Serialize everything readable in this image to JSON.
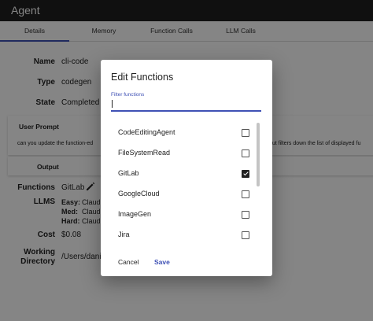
{
  "app": {
    "title": "Agent"
  },
  "tabs": [
    {
      "label": "Details",
      "active": true
    },
    {
      "label": "Memory",
      "active": false
    },
    {
      "label": "Function Calls",
      "active": false
    },
    {
      "label": "LLM Calls",
      "active": false
    }
  ],
  "details": {
    "name_label": "Name",
    "name_value": "cli-code",
    "type_label": "Type",
    "type_value": "codegen",
    "state_label": "State",
    "state_value": "Completed",
    "user_prompt_title": "User Prompt",
    "user_prompt_left": "can you update the function-ed",
    "user_prompt_right": "put filters down the list of displayed fu",
    "output_title": "Output",
    "functions_label": "Functions",
    "functions_value": "GitLab",
    "llms_label": "LLMS",
    "llms": [
      {
        "label": "Easy:",
        "value": "Claud"
      },
      {
        "label": "Med:",
        "value": "Claud"
      },
      {
        "label": "Hard:",
        "value": "Claud"
      }
    ],
    "cost_label": "Cost",
    "cost_value": "$0.08",
    "working_label_1": "Working",
    "working_label_2": "Directory",
    "working_value": "/Users/daniel"
  },
  "dialog": {
    "title": "Edit Functions",
    "filter_label": "Filter functions",
    "filter_value": "",
    "items": [
      {
        "label": "CodeEditingAgent",
        "checked": false
      },
      {
        "label": "FileSystemRead",
        "checked": false
      },
      {
        "label": "GitLab",
        "checked": true
      },
      {
        "label": "GoogleCloud",
        "checked": false
      },
      {
        "label": "ImageGen",
        "checked": false
      },
      {
        "label": "Jira",
        "checked": false
      }
    ],
    "cancel_label": "Cancel",
    "save_label": "Save"
  },
  "colors": {
    "accent": "#3f51b5",
    "topbar": "#1f1f1f"
  }
}
